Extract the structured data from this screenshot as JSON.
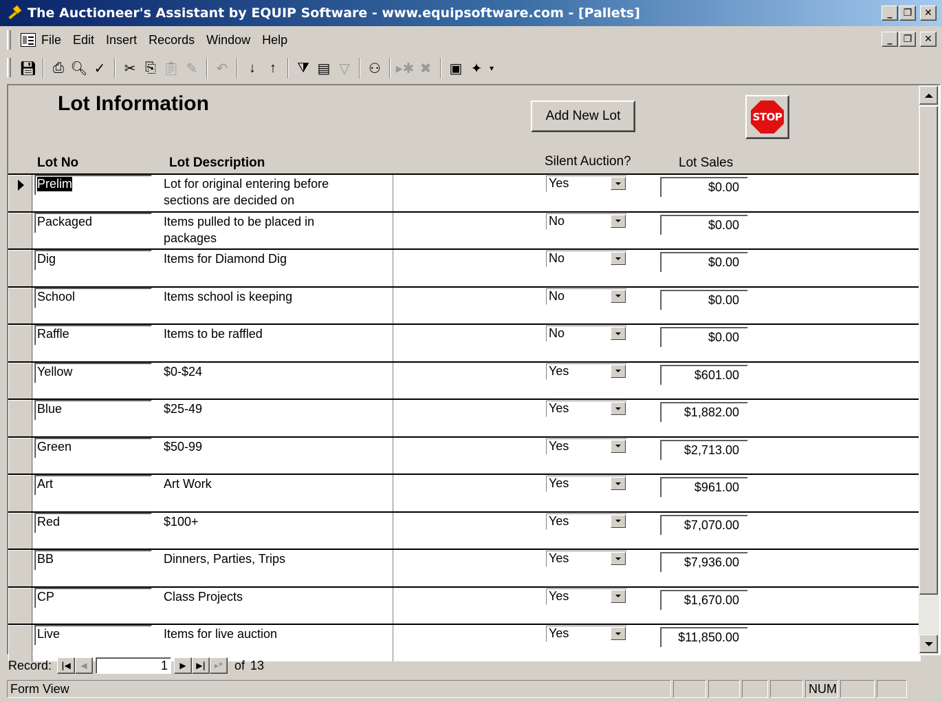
{
  "window": {
    "title": "The Auctioneer's Assistant by EQUIP Software - www.equipsoftware.com - [Pallets]",
    "min": "_",
    "max": "❐",
    "close": "✕"
  },
  "menu": {
    "items": [
      "File",
      "Edit",
      "Insert",
      "Records",
      "Window",
      "Help"
    ]
  },
  "form": {
    "title": "Lot Information",
    "add_button": "Add New Lot",
    "stop_label": "STOP",
    "headers": {
      "lot_no": "Lot No",
      "lot_description": "Lot  Description",
      "silent_auction": "Silent Auction?",
      "lot_sales": "Lot Sales"
    }
  },
  "lots": [
    {
      "no": "Prelim",
      "desc": "Lot for original entering before sections are decided on",
      "silent": "Yes",
      "sales": "$0.00"
    },
    {
      "no": "Packaged",
      "desc": "Items pulled to be placed in packages",
      "silent": "No",
      "sales": "$0.00"
    },
    {
      "no": "Dig",
      "desc": "Items for Diamond Dig",
      "silent": "No",
      "sales": "$0.00"
    },
    {
      "no": "School",
      "desc": "Items school is keeping",
      "silent": "No",
      "sales": "$0.00"
    },
    {
      "no": "Raffle",
      "desc": "Items to be raffled",
      "silent": "No",
      "sales": "$0.00"
    },
    {
      "no": "Yellow",
      "desc": "$0-$24",
      "silent": "Yes",
      "sales": "$601.00"
    },
    {
      "no": "Blue",
      "desc": "$25-49",
      "silent": "Yes",
      "sales": "$1,882.00"
    },
    {
      "no": "Green",
      "desc": "$50-99",
      "silent": "Yes",
      "sales": "$2,713.00"
    },
    {
      "no": "Art",
      "desc": "Art Work",
      "silent": "Yes",
      "sales": "$961.00"
    },
    {
      "no": "Red",
      "desc": "$100+",
      "silent": "Yes",
      "sales": "$7,070.00"
    },
    {
      "no": "BB",
      "desc": "Dinners, Parties, Trips",
      "silent": "Yes",
      "sales": "$7,936.00"
    },
    {
      "no": "CP",
      "desc": "Class Projects",
      "silent": "Yes",
      "sales": "$1,670.00"
    },
    {
      "no": "Live",
      "desc": "Items for live auction",
      "silent": "Yes",
      "sales": "$11,850.00"
    }
  ],
  "navigator": {
    "label": "Record:",
    "current": "1",
    "of_label": "of",
    "total": "13"
  },
  "status": {
    "view": "Form View",
    "num": "NUM"
  }
}
